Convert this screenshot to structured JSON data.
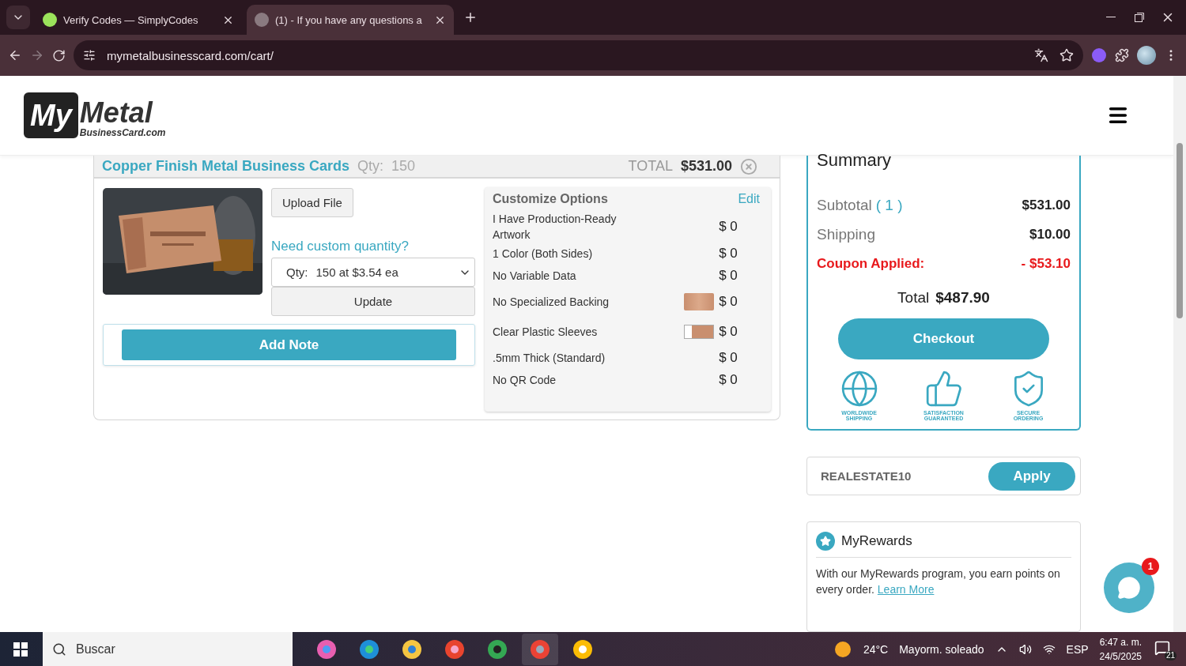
{
  "browser": {
    "tabs": [
      {
        "title": "Verify Codes — SimplyCodes",
        "selected": false
      },
      {
        "title": "(1) - If you have any questions a",
        "selected": true
      }
    ],
    "url": "mymetalbusinesscard.com/cart/"
  },
  "logo": {
    "mark": "My",
    "word": "Metal",
    "sub": "BusinessCard.com"
  },
  "cart_item": {
    "title": "Copper Finish Metal Business Cards",
    "qty_label": "Qty:",
    "qty": "150",
    "total_label": "TOTAL",
    "total": "$531.00",
    "upload_button": "Upload File",
    "custom_qty_link": "Need custom quantity?",
    "qty_select": {
      "label": "Qty:",
      "value": "150 at $3.54 ea"
    },
    "update_button": "Update",
    "add_note_button": "Add Note"
  },
  "options": {
    "title": "Customize Options",
    "edit": "Edit",
    "rows": [
      {
        "label": "I Have Production-Ready Artwork",
        "price": "$ 0",
        "kind": "plain"
      },
      {
        "label": "1 Color (Both Sides)",
        "price": "$ 0",
        "kind": "plain"
      },
      {
        "label": "No Variable Data",
        "price": "$ 0",
        "kind": "plain"
      },
      {
        "label": "No Specialized Backing",
        "price": "$ 0",
        "kind": "swatch"
      },
      {
        "label": "Clear Plastic Sleeves",
        "price": "$ 0",
        "kind": "sleeve"
      },
      {
        "label": ".5mm Thick (Standard)",
        "price": "$ 0",
        "kind": "plain"
      },
      {
        "label": "No QR Code",
        "price": "$ 0",
        "kind": "plain"
      }
    ]
  },
  "summary": {
    "title": "Summary",
    "rows": [
      {
        "label": "Subtotal",
        "count": "( 1 )",
        "value": "$531.00",
        "kind": "normal"
      },
      {
        "label": "Shipping",
        "value": "$10.00",
        "kind": "normal"
      },
      {
        "label": "Coupon Applied:",
        "value": "- $53.10",
        "kind": "discount"
      }
    ],
    "total_label": "Total",
    "total": "$487.90",
    "checkout_button": "Checkout",
    "badges": [
      {
        "label": "WORLDWIDE SHIPPING",
        "kind": "globe"
      },
      {
        "label": "SATISFACTION GUARANTEED",
        "kind": "thumb"
      },
      {
        "label": "SECURE ORDERING",
        "kind": "lock"
      }
    ]
  },
  "coupon": {
    "value": "REALESTATE10",
    "button": "Apply"
  },
  "rewards": {
    "title": "MyRewards",
    "text": "With our MyRewards program, you earn points on every order.",
    "link": "Learn More"
  },
  "chat": {
    "badge": "1"
  },
  "taskbar": {
    "search_placeholder": "Buscar",
    "temperature": "24°C",
    "weather": "Mayorm. soleado",
    "language": "ESP",
    "time": "6:47 a. m.",
    "date": "24/5/2025",
    "notifications": "21"
  }
}
